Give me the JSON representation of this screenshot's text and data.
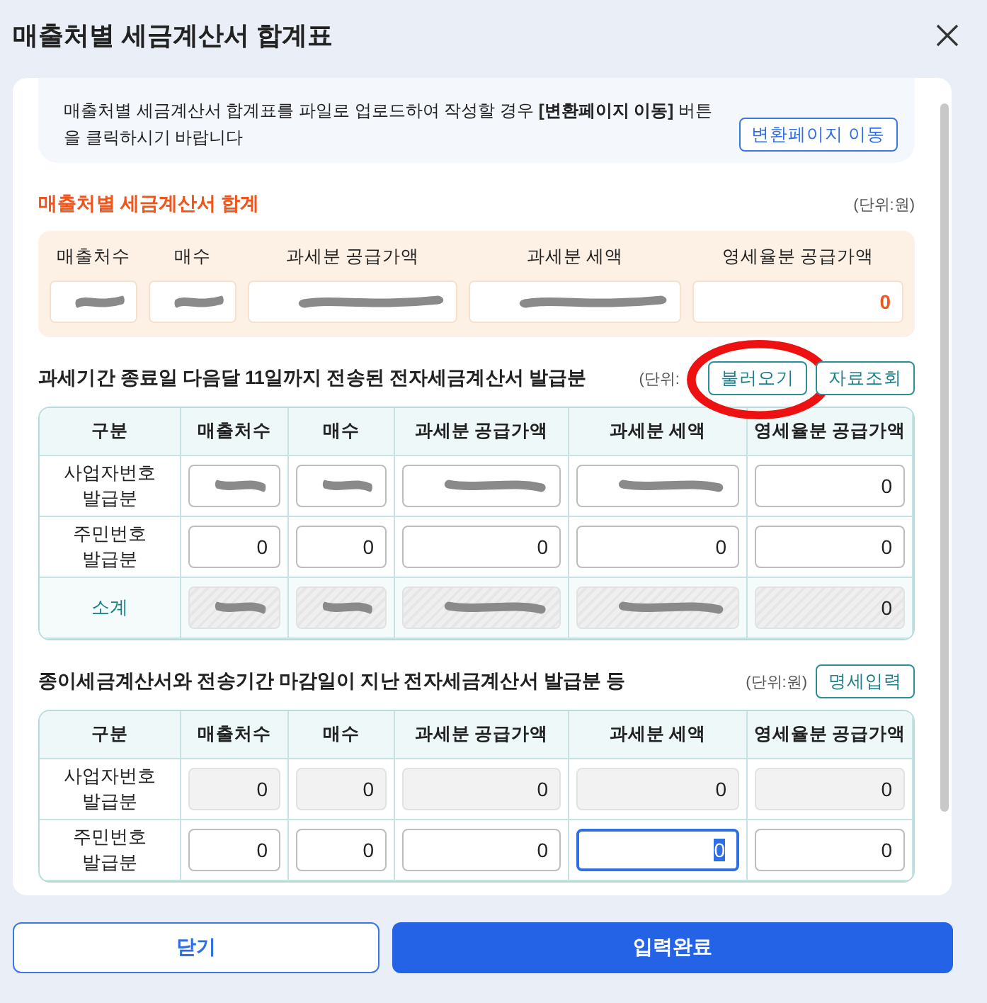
{
  "window": {
    "title": "매출처별 세금계산서 합계표"
  },
  "notice": {
    "text": "매출처별 세금계산서 합계표를 파일로 업로드하여 작성할 경우 **[변환페이지 이동]** 버튼을 클릭하시기 바랍니다",
    "button": "변환페이지 이동"
  },
  "summary": {
    "title": "매출처별 세금계산서 합계",
    "unit": "(단위:원)",
    "columns": [
      "매출처수",
      "매수",
      "과세분 공급가액",
      "과세분 세액",
      "영세율분 공급가액"
    ],
    "cells": [
      {
        "redacted": true
      },
      {
        "redacted": true
      },
      {
        "redacted": true
      },
      {
        "redacted": true
      },
      {
        "value": "0",
        "redacted": false
      }
    ]
  },
  "sections": [
    {
      "title": "과세기간 종료일 다음달 11일까지 전송된 전자세금계산서 발급분",
      "unit": "(단위:",
      "buttons": [
        {
          "label": "불러오기",
          "circled": true
        },
        {
          "label": "자료조회",
          "circled": false
        }
      ],
      "row_header": "구분",
      "columns": [
        "매출처수",
        "매수",
        "과세분 공급가액",
        "과세분 세액",
        "영세율분 공급가액"
      ],
      "rows": [
        {
          "kind": "input",
          "label": "사업자번호\n발급분",
          "cells": [
            {
              "redacted": true,
              "readonly": false,
              "focused": false
            },
            {
              "redacted": true,
              "readonly": false,
              "focused": false
            },
            {
              "redacted": true,
              "readonly": false,
              "focused": false
            },
            {
              "redacted": true,
              "readonly": false,
              "focused": false
            },
            {
              "value": "0",
              "redacted": false,
              "readonly": false,
              "focused": false
            }
          ]
        },
        {
          "kind": "input",
          "label": "주민번호\n발급분",
          "cells": [
            {
              "value": "0",
              "redacted": false,
              "readonly": false,
              "focused": false
            },
            {
              "value": "0",
              "redacted": false,
              "readonly": false,
              "focused": false
            },
            {
              "value": "0",
              "redacted": false,
              "readonly": false,
              "focused": false
            },
            {
              "value": "0",
              "redacted": false,
              "readonly": false,
              "focused": false
            },
            {
              "value": "0",
              "redacted": false,
              "readonly": false,
              "focused": false
            }
          ]
        },
        {
          "kind": "subtotal",
          "label": "소계",
          "cells": [
            {
              "redacted": true,
              "readonly": true,
              "focused": false
            },
            {
              "redacted": true,
              "readonly": true,
              "focused": false
            },
            {
              "redacted": true,
              "readonly": true,
              "focused": false
            },
            {
              "redacted": true,
              "readonly": true,
              "focused": false
            },
            {
              "value": "0",
              "redacted": false,
              "readonly": true,
              "focused": false
            }
          ]
        }
      ]
    },
    {
      "title": "종이세금계산서와 전송기간 마감일이 지난 전자세금계산서 발급분 등",
      "unit": "(단위:원)",
      "buttons": [
        {
          "label": "명세입력",
          "circled": false
        }
      ],
      "row_header": "구분",
      "columns": [
        "매출처수",
        "매수",
        "과세분 공급가액",
        "과세분 세액",
        "영세율분 공급가액"
      ],
      "rows": [
        {
          "kind": "input",
          "label": "사업자번호\n발급분",
          "cells": [
            {
              "value": "0",
              "redacted": false,
              "readonly": true,
              "focused": false
            },
            {
              "value": "0",
              "redacted": false,
              "readonly": true,
              "focused": false
            },
            {
              "value": "0",
              "redacted": false,
              "readonly": true,
              "focused": false
            },
            {
              "value": "0",
              "redacted": false,
              "readonly": true,
              "focused": false
            },
            {
              "value": "0",
              "redacted": false,
              "readonly": true,
              "focused": false
            }
          ]
        },
        {
          "kind": "input",
          "label": "주민번호\n발급분",
          "cells": [
            {
              "value": "0",
              "redacted": false,
              "readonly": false,
              "focused": false
            },
            {
              "value": "0",
              "redacted": false,
              "readonly": false,
              "focused": false
            },
            {
              "value": "0",
              "redacted": false,
              "readonly": false,
              "focused": false
            },
            {
              "value": "0",
              "redacted": false,
              "readonly": false,
              "focused": true
            },
            {
              "value": "0",
              "redacted": false,
              "readonly": false,
              "focused": false
            }
          ]
        }
      ]
    }
  ],
  "footer": {
    "buttons": [
      {
        "label": "닫기",
        "kind": "secondary"
      },
      {
        "label": "입력완료",
        "kind": "primary"
      }
    ]
  }
}
